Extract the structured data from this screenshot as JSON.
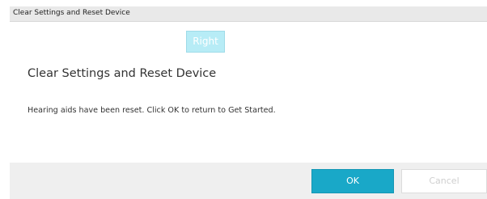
{
  "window": {
    "title": "Clear Settings and Reset Device"
  },
  "content": {
    "side_badge": "Right",
    "heading": "Clear Settings and Reset Device",
    "message": "Hearing aids have been reset.  Click OK to return to Get Started."
  },
  "footer": {
    "ok_label": "OK",
    "cancel_label": "Cancel",
    "cancel_enabled": false
  },
  "colors": {
    "accent": "#19a8c8",
    "badge_bg": "#b7ecf6",
    "titlebar_bg": "#e9e9e9",
    "footer_bg": "#efefef"
  }
}
